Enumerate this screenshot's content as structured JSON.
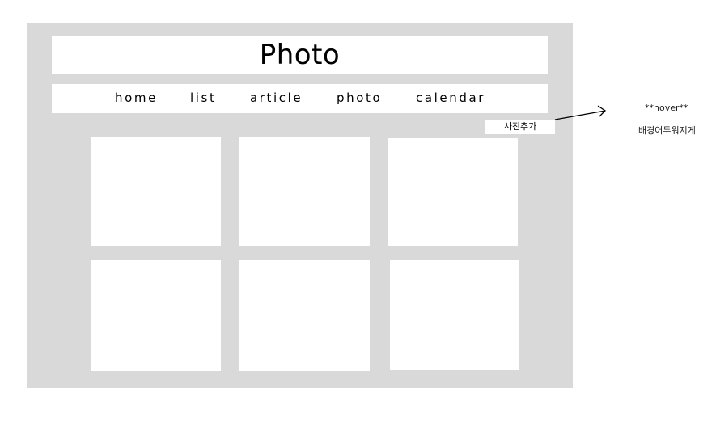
{
  "header": {
    "title": "Photo"
  },
  "nav": {
    "items": [
      {
        "label": "home"
      },
      {
        "label": "list"
      },
      {
        "label": "article"
      },
      {
        "label": "photo"
      },
      {
        "label": "calendar"
      }
    ]
  },
  "toolbar": {
    "add_photo_label": "사진추가"
  },
  "gallery": {
    "count": 6
  },
  "annotation": {
    "hover_label": "**hover**",
    "hover_note": "배경어두워지게"
  },
  "colors": {
    "frame_background": "#d9d9d9",
    "panel_background": "#ffffff",
    "text": "#000000"
  }
}
